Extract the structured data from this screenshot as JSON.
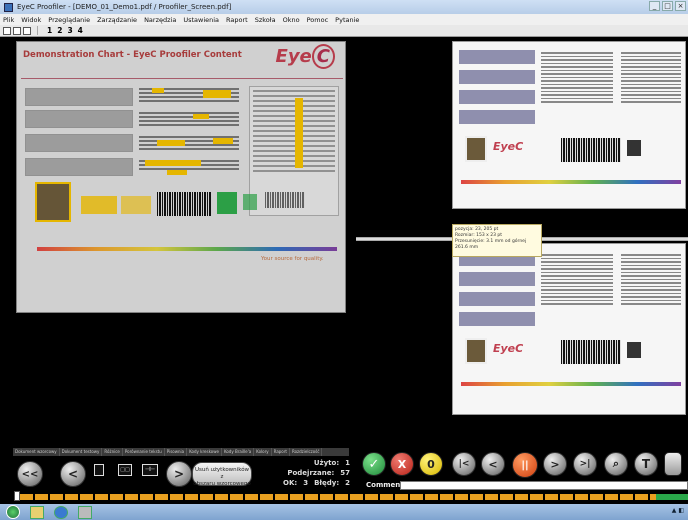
{
  "window": {
    "title": "EyeC Proofiler - [DEMO_01_Demo1.pdf / Proofiler_Screen.pdf]",
    "controls": [
      "_",
      "□",
      "×"
    ]
  },
  "menu": [
    "Plik",
    "Widok",
    "Przeglądanie",
    "Zarządzanie",
    "Narzędzia",
    "Ustawienia",
    "Raport",
    "Szkoła",
    "Okno",
    "Pomoc",
    "Pytanie"
  ],
  "toolbar": {
    "pages": [
      "1",
      "2",
      "3",
      "4"
    ]
  },
  "left_doc": {
    "title": "Demonstration Chart - EyeC Proofiler Content",
    "logo": "EyeC",
    "footer": "Your source for quality."
  },
  "tooltip": {
    "lines": [
      "pozycja: 23, 205 pt",
      "Rozmiar: 153 x 23 pt",
      "Przesunięcie: 3.1 mm od górnej",
      "261.6 mm"
    ]
  },
  "tabs": [
    "Dokument wzorcowy",
    "Dokument testowy",
    "Różnice",
    "Porównanie tekstu",
    "Pisownia",
    "Kody kreskowe",
    "Kody Braille'a",
    "Kolory",
    "Raport",
    "Rozdzielczość"
  ],
  "controls": {
    "rewind_label": "<<",
    "prev_label": "<",
    "next_label": ">",
    "count_button_lines": [
      "Usuń użytkowników z",
      "obszaru wzorcowego"
    ],
    "ok_label": "✓",
    "reject_label": "X",
    "zero_label": "0",
    "first_label": "|<",
    "back_label": "<",
    "pause_label": "||",
    "fwd_label": ">",
    "last_label": ">|",
    "zoom_icon": "magnifier-icon",
    "text_label": "T"
  },
  "counters": {
    "uzyte_label": "Użyto:",
    "uzyte_value": "1",
    "podejrzane_label": "Podejrzane:",
    "podejrzane_value": "57",
    "ok_label": "OK:",
    "ok_value": "3",
    "bledy_label": "Błędy:",
    "bledy_value": "2"
  },
  "comment": {
    "label": "Comment:",
    "value": ""
  },
  "colors": {
    "accent_orange": "#e8a020",
    "ok_green": "#2fa84a",
    "reject_red": "#c8302a",
    "pause_orange": "#e05a20",
    "zero_yellow": "#f2d200"
  }
}
